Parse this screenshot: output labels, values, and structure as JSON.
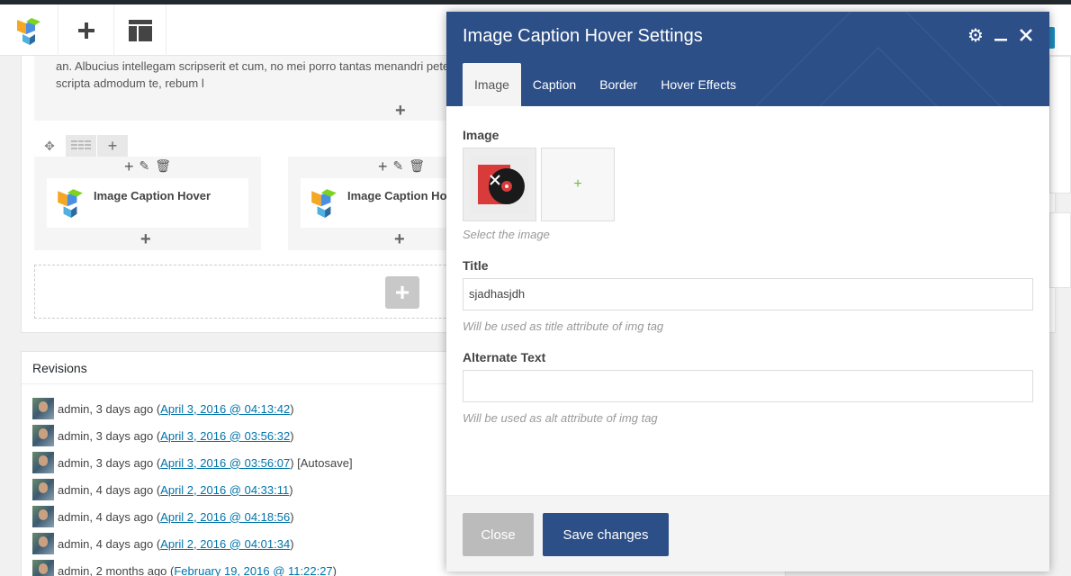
{
  "navbar": {
    "logo_icon": "vc-logo-icon",
    "add_icon": "plus-icon",
    "templates_icon": "templates-icon"
  },
  "builder": {
    "text_block": "an. Albucius intellegam scripserit et cum, no mei porro tantas menandri petentium repudiandae eum ut. Pri reque scripta admodum te, rebum l",
    "columns": [
      {
        "element_title": "Image Caption Hover"
      },
      {
        "element_title": "Image Caption Hover"
      }
    ]
  },
  "revisions": {
    "title": "Revisions",
    "items": [
      {
        "prefix": "admin, 3 days ago (",
        "link": "April 3, 2016 @ 04:13:42",
        "suffix": ")"
      },
      {
        "prefix": "admin, 3 days ago (",
        "link": "April 3, 2016 @ 03:56:32",
        "suffix": ")"
      },
      {
        "prefix": "admin, 3 days ago (",
        "link": "April 3, 2016 @ 03:56:07",
        "suffix": ") [Autosave]"
      },
      {
        "prefix": "admin, 4 days ago (",
        "link": "April 2, 2016 @ 04:33:11",
        "suffix": ")"
      },
      {
        "prefix": "admin, 4 days ago (",
        "link": "April 2, 2016 @ 04:18:56",
        "suffix": ")"
      },
      {
        "prefix": "admin, 4 days ago (",
        "link": "April 2, 2016 @ 04:01:34",
        "suffix": ")"
      },
      {
        "prefix": "admin, 2 months ago (",
        "link": "February 19, 2016 @ 11:22:27",
        "suffix": ")"
      }
    ]
  },
  "modal": {
    "title": "Image Caption Hover Settings",
    "tabs": [
      {
        "label": "Image",
        "active": true
      },
      {
        "label": "Caption",
        "active": false
      },
      {
        "label": "Border",
        "active": false
      },
      {
        "label": "Hover Effects",
        "active": false
      }
    ],
    "image_label": "Image",
    "image_add": "+",
    "image_help": "Select the image",
    "title_label": "Title",
    "title_value": "sjadhasjdh",
    "title_help": "Will be used as title attribute of img tag",
    "alt_label": "Alternate Text",
    "alt_value": "",
    "alt_help": "Will be used as alt attribute of img tag",
    "close_label": "Close",
    "save_label": "Save changes"
  },
  "colors": {
    "modal_header": "#2d4f88",
    "save_button": "#2d4f88",
    "close_button": "#bbbbbb",
    "link": "#0073aa"
  }
}
